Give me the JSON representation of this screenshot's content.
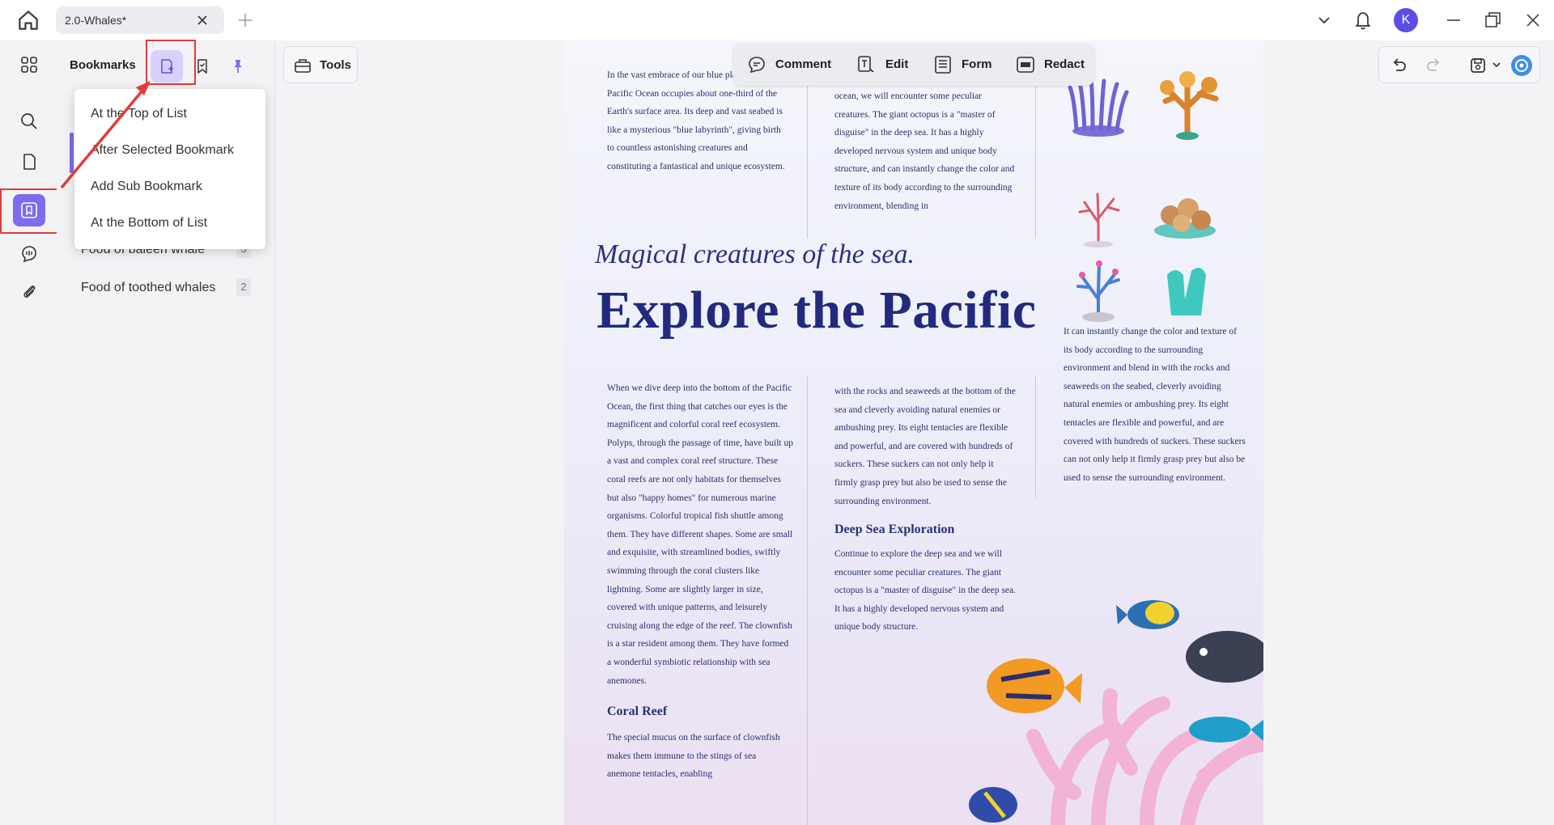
{
  "titlebar": {
    "tab_title": "2.0-Whales*",
    "avatar_letter": "K"
  },
  "bookmarks": {
    "title": "Bookmarks",
    "items": [
      {
        "label": "Food of baleen whale",
        "count": "3"
      },
      {
        "label": "Food of toothed whales",
        "count": "2"
      }
    ]
  },
  "add_menu": {
    "items": [
      "At the Top of List",
      "After Selected Bookmark",
      "Add Sub Bookmark",
      "At the Bottom of List"
    ]
  },
  "tools": {
    "label": "Tools"
  },
  "edit_toolbar": {
    "comment": "Comment",
    "edit": "Edit",
    "form": "Form",
    "redact": "Redact"
  },
  "doc": {
    "col1_top": "In the vast embrace of our blue planet, the Pacific Ocean occupies about one-third of the Earth's surface area. Its deep and vast seabed is like a mysterious \"blue labyrinth\", giving birth to countless astonishing creatures and constituting a fantastical and unique ecosystem.",
    "col2_top": "ocean, we will encounter some peculiar creatures. The giant octopus is a \"master of disguise\" in the deep sea. It has a highly developed nervous system and unique body structure, and can instantly change the color and texture of its body according to the surrounding environment, blending in",
    "script_title": "Magical creatures of the sea.",
    "big_title": "Explore the Pacific",
    "col3_mid": "It can instantly change the color and texture of its body according to the surrounding environment and blend in with the rocks and seaweeds on the seabed, cleverly avoiding natural enemies or ambushing prey. Its eight tentacles are flexible and powerful, and are covered with hundreds of suckers. These suckers can not only help it firmly grasp prey but also be used to sense the surrounding environment.",
    "col1_mid": "When we dive deep into the bottom of the Pacific Ocean, the first thing that catches our eyes is the magnificent and colorful coral reef ecosystem. Polyps, through the passage of time, have built up a vast and complex coral reef structure. These coral reefs are not only habitats for themselves but also \"happy homes\" for numerous marine organisms. Colorful tropical fish shuttle among them. They have different shapes. Some are small and exquisite, with streamlined bodies, swiftly swimming through the coral clusters like lightning. Some are slightly larger in size, covered with unique patterns, and leisurely cruising along the edge of the reef. The clownfish is a star resident among them. They have formed a wonderful symbiotic relationship with sea anemones.",
    "col2_mid": "with the rocks and seaweeds at the bottom of the sea and cleverly avoiding natural enemies or ambushing prey. Its eight tentacles are flexible and powerful, and are covered with hundreds of suckers. These suckers can not only help it firmly grasp prey but also be used to sense the surrounding environment.",
    "deep_sea_head": "Deep Sea Exploration",
    "deep_sea_text": "Continue to explore the deep sea and we will encounter some peculiar creatures. The giant octopus is a \"master of disguise\" in the deep sea. It has a highly developed nervous system and unique body structure.",
    "coral_head": "Coral Reef",
    "coral_text": "The special mucus on the surface of clownfish makes them immune to the stings of sea anemone tentacles, enabling"
  },
  "colors": {
    "accent": "#7b6cf0",
    "highlight": "#e23b3b",
    "title_ink": "#232a7e"
  }
}
